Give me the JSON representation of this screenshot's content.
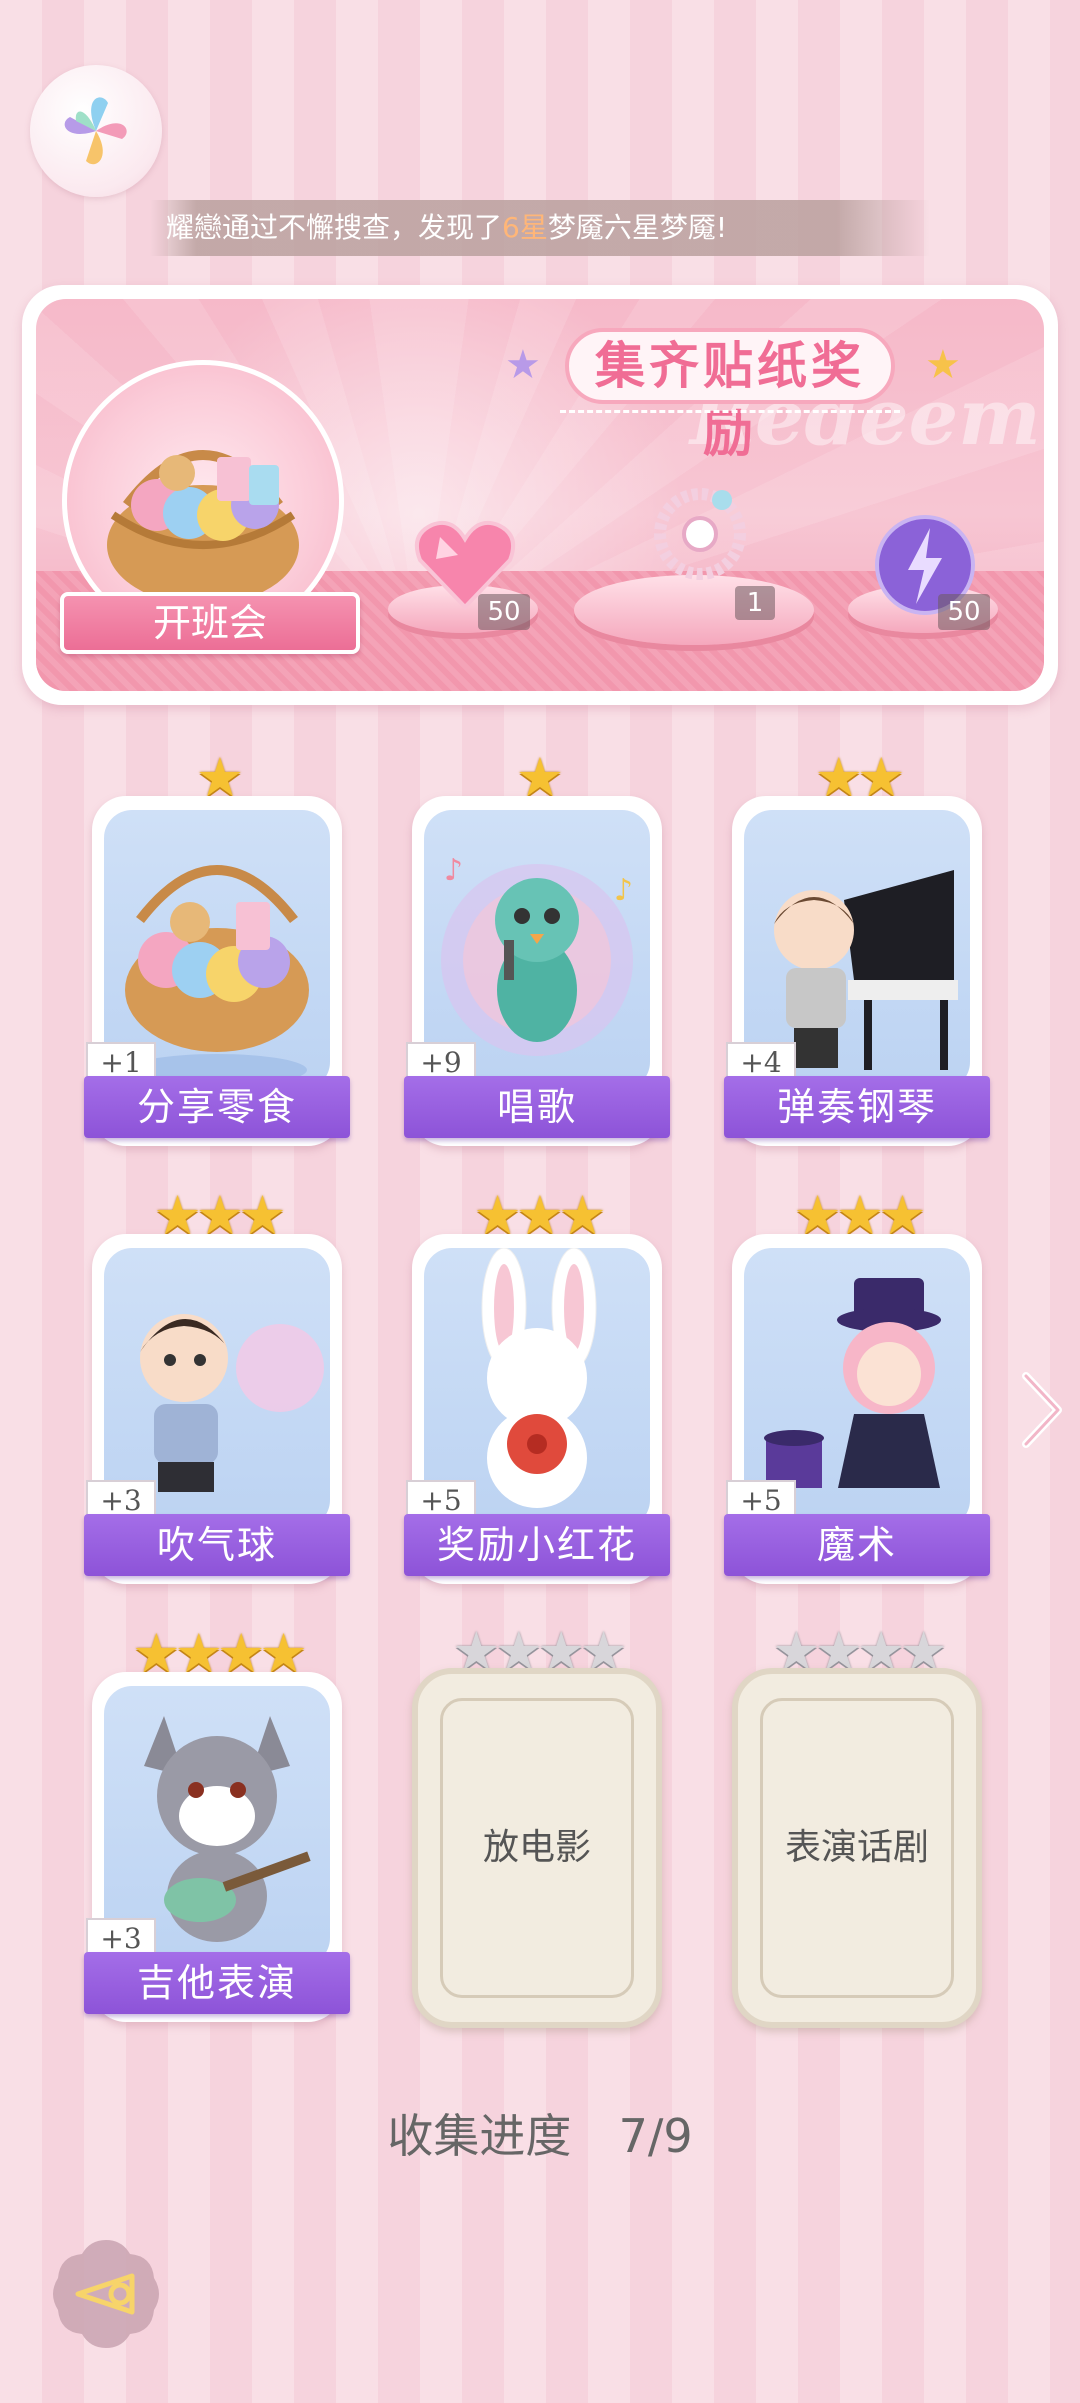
{
  "ticker": {
    "prefix": "耀戀通过不懈搜查，发现了",
    "highlight": "6星",
    "suffix": "梦魇六星梦魇!"
  },
  "reward_panel": {
    "title": "集齐贴纸奖励",
    "watermark": "Redeem",
    "badge_label": "开班会",
    "rewards": [
      {
        "icon": "pink-heart-gem-icon",
        "count": "50"
      },
      {
        "icon": "jewel-ring-icon",
        "count": "1"
      },
      {
        "icon": "purple-lightning-orb-icon",
        "count": "50"
      }
    ]
  },
  "cards": [
    {
      "label": "分享零食",
      "bonus": "+1",
      "stars": 1,
      "art": "snack-basket-icon"
    },
    {
      "label": "唱歌",
      "bonus": "+9",
      "stars": 1,
      "art": "peacock-singing-icon"
    },
    {
      "label": "弹奏钢琴",
      "bonus": "+4",
      "stars": 2,
      "art": "boy-piano-icon"
    },
    {
      "label": "吹气球",
      "bonus": "+3",
      "stars": 3,
      "art": "boy-bubble-icon"
    },
    {
      "label": "奖励小红花",
      "bonus": "+5",
      "stars": 3,
      "art": "bunny-red-flower-icon"
    },
    {
      "label": "魔术",
      "bonus": "+5",
      "stars": 3,
      "art": "magician-girl-icon"
    },
    {
      "label": "吉他表演",
      "bonus": "+3",
      "stars": 4,
      "art": "wolf-guitar-icon"
    },
    {
      "label": "放电影",
      "stars": 4,
      "locked": true
    },
    {
      "label": "表演话剧",
      "stars": 4,
      "locked": true
    }
  ],
  "progress": {
    "label": "收集进度",
    "value": "7/9"
  },
  "colors": {
    "accent_pink": "#f06d95",
    "label_purple": "#9a60e0",
    "star_gold": "#f6c132",
    "highlight_orange": "#ffb678"
  }
}
